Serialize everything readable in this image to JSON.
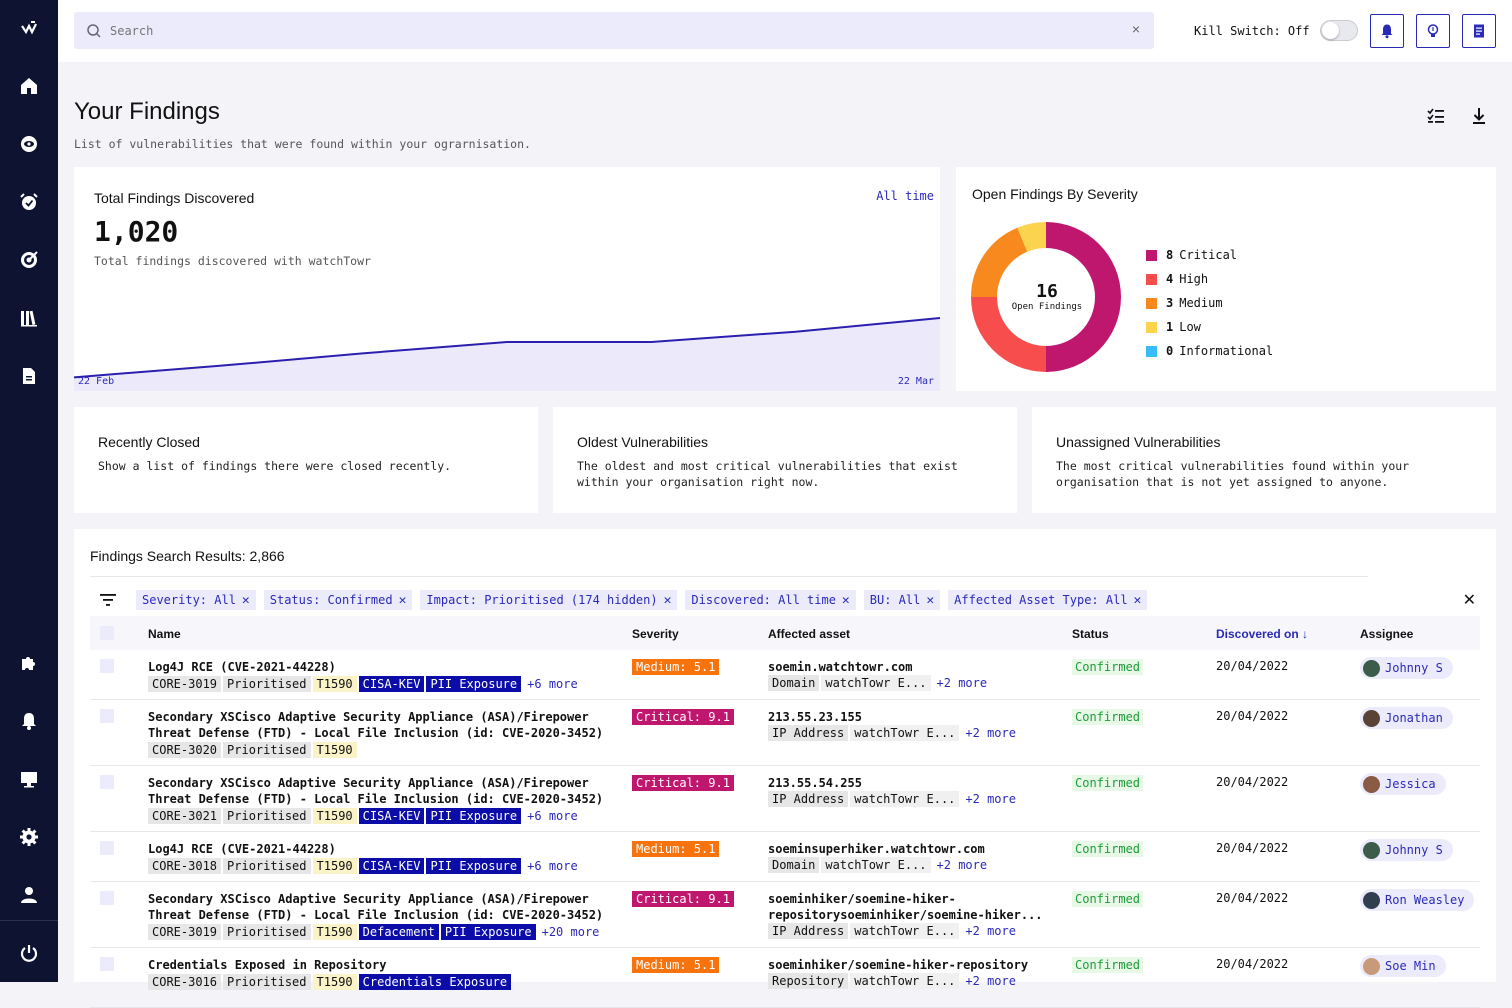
{
  "search": {
    "placeholder": "Search",
    "clear": "×"
  },
  "topbar": {
    "kill_switch_label": "Kill Switch: Off"
  },
  "page": {
    "title": "Your Findings",
    "subtitle": "List of vulnerabilities that were found within your ograrnisation."
  },
  "total_card": {
    "title": "Total Findings Discovered",
    "range": "All time",
    "count": "1,020",
    "description": "Total findings discovered with watchTowr",
    "x_start": "22 Feb",
    "x_end": "22 Mar"
  },
  "chart_data": {
    "type": "area",
    "x": [
      "22 Feb",
      "",
      "",
      "",
      "",
      "",
      "22 Mar"
    ],
    "values": [
      0.12,
      0.22,
      0.33,
      0.43,
      0.43,
      0.52,
      0.64
    ],
    "xlabel": "",
    "ylabel": ""
  },
  "severity_card": {
    "title": "Open Findings By Severity",
    "total": "16",
    "total_label": "Open Findings",
    "items": [
      {
        "count": "8",
        "label": "Critical",
        "value": 8,
        "color": "#c0176e"
      },
      {
        "count": "4",
        "label": "High",
        "value": 4,
        "color": "#f74d4d"
      },
      {
        "count": "3",
        "label": "Medium",
        "value": 3,
        "color": "#f7891e"
      },
      {
        "count": "1",
        "label": "Low",
        "value": 1,
        "color": "#fcd34d"
      },
      {
        "count": "0",
        "label": "Informational",
        "value": 0,
        "color": "#38bdf8"
      }
    ]
  },
  "mini_cards": [
    {
      "title": "Recently Closed",
      "desc": "Show a list of findings there were closed recently."
    },
    {
      "title": "Oldest Vulnerabilities",
      "desc": "The oldest and most critical vulnerabilities that exist within your organisation right now."
    },
    {
      "title": "Unassigned Vulnerabilities",
      "desc": "The most critical vulnerabilities found within your organisation that is not yet assigned to anyone."
    }
  ],
  "results": {
    "title": "Findings Search Results: 2,866",
    "filters": [
      "Severity: All",
      "Status: Confirmed",
      "Impact: Prioritised (174 hidden)",
      "Discovered: All time",
      "BU: All",
      "Affected Asset Type: All"
    ],
    "columns": {
      "name": "Name",
      "severity": "Severity",
      "asset": "Affected asset",
      "status": "Status",
      "discovered": "Discovered on ↓",
      "assignee": "Assignee"
    },
    "rows": [
      {
        "name": "Log4J RCE (CVE-2021-44228)",
        "id": "CORE-3019",
        "pri": "Prioritised",
        "tech": "T1590",
        "tags": [
          "CISA-KEV",
          "PII Exposure"
        ],
        "more": "+6 more",
        "severity": "Medium: 5.1",
        "sev": "med",
        "asset": "soemin.watchtowr.com",
        "asset_type": "Domain",
        "asset_bu": "watchTowr E...",
        "asset_more": "+2 more",
        "status": "Confirmed",
        "date": "20/04/2022",
        "assignee": "Johnny S",
        "av": "#3b5b4b"
      },
      {
        "name": "Secondary XSCisco Adaptive Security Appliance (ASA)/Firepower Threat Defense (FTD) - Local File Inclusion (id: CVE-2020-3452)",
        "id": "CORE-3020",
        "pri": "Prioritised",
        "tech": "T1590",
        "tags": [],
        "more": "",
        "severity": "Critical: 9.1",
        "sev": "crit",
        "asset": "213.55.23.155",
        "asset_type": "IP Address",
        "asset_bu": "watchTowr E...",
        "asset_more": "+2 more",
        "status": "Confirmed",
        "date": "20/04/2022",
        "assignee": "Jonathan",
        "av": "#5a4336"
      },
      {
        "name": "Secondary XSCisco Adaptive Security Appliance (ASA)/Firepower Threat Defense (FTD) - Local File Inclusion (id: CVE-2020-3452)",
        "id": "CORE-3021",
        "pri": "Prioritised",
        "tech": "T1590",
        "tags": [
          "CISA-KEV",
          "PII Exposure"
        ],
        "more": "+6 more",
        "severity": "Critical: 9.1",
        "sev": "crit",
        "asset": "213.55.54.255",
        "asset_type": "IP Address",
        "asset_bu": "watchTowr E...",
        "asset_more": "+2 more",
        "status": "Confirmed",
        "date": "20/04/2022",
        "assignee": "Jessica",
        "av": "#8a5a44"
      },
      {
        "name": "Log4J RCE (CVE-2021-44228)",
        "id": "CORE-3018",
        "pri": "Prioritised",
        "tech": "T1590",
        "tags": [
          "CISA-KEV",
          "PII Exposure"
        ],
        "more": "+6 more",
        "severity": "Medium: 5.1",
        "sev": "med",
        "asset": "soeminsuperhiker.watchtowr.com",
        "asset_type": "Domain",
        "asset_bu": "watchTowr E...",
        "asset_more": "+2 more",
        "status": "Confirmed",
        "date": "20/04/2022",
        "assignee": "Johnny S",
        "av": "#3b5b4b"
      },
      {
        "name": "Secondary XSCisco Adaptive Security Appliance (ASA)/Firepower Threat Defense (FTD) - Local File Inclusion (id: CVE-2020-3452)",
        "id": "CORE-3019",
        "pri": "Prioritised",
        "tech": "T1590",
        "tags": [
          "Defacement",
          "PII Exposure"
        ],
        "more": "+20 more",
        "severity": "Critical: 9.1",
        "sev": "crit",
        "asset": "soeminhiker/soemine-hiker-repositorysoeminhiker/soemine-hiker...",
        "asset_type": "IP Address",
        "asset_bu": "watchTowr E...",
        "asset_more": "+2 more",
        "status": "Confirmed",
        "date": "20/04/2022",
        "assignee": "Ron Weasley",
        "av": "#2f3f4f"
      },
      {
        "name": "Credentials Exposed in Repository",
        "id": "CORE-3016",
        "pri": "Prioritised",
        "tech": "T1590",
        "tags": [
          "Credentials Exposure"
        ],
        "more": "",
        "severity": "Medium: 5.1",
        "sev": "med",
        "asset": "soeminhiker/soemine-hiker-repository",
        "asset_type": "Repository",
        "asset_bu": "watchTowr E...",
        "asset_more": "+2 more",
        "status": "Confirmed",
        "date": "20/04/2022",
        "assignee": "Soe Min",
        "av": "#c99a7a"
      }
    ]
  }
}
